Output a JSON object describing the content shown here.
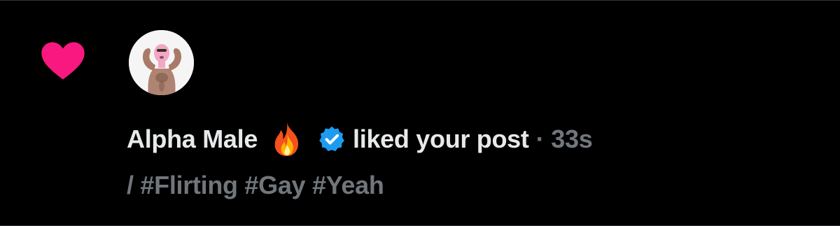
{
  "notification": {
    "type_icon": "heart-icon",
    "user": {
      "name": "Alpha Male",
      "name_emoji": "fire-emoji",
      "verified": true,
      "avatar": "avatar-photo"
    },
    "action": "liked your post",
    "separator": "·",
    "time_ago": "33s",
    "post_preview": "/ #Flirting #Gay #Yeah"
  },
  "colors": {
    "background": "#000000",
    "like_pink": "#f91880",
    "verified_blue": "#1d9bf0",
    "primary_text": "#e7e9ea",
    "secondary_text": "#71767b"
  }
}
